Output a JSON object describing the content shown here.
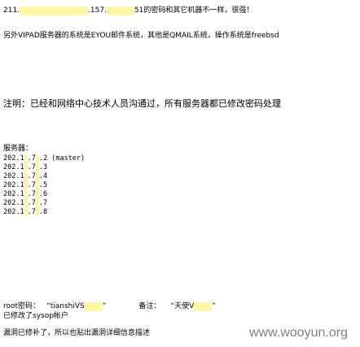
{
  "colors": {
    "text": "#000000",
    "highlight": "#fff6a6",
    "watermark": "#808080",
    "background": "#ffffff"
  },
  "intro": {
    "ip_prefix": "211.",
    "ip_middle": ".157.",
    "message": "51的密码和其它机器不一样，很强！"
  },
  "system_info": "另外VIPAD服务器的系统是EYOU邮件系统，其他是QMAIL系统，操作系统是freebsd",
  "note": "注明：已经和网络中心技术人员沟通过，所有服务器都已修改密码处理",
  "servers": {
    "label": "服务器：",
    "list": [
      {
        "prefix": "202.1",
        "mid": ".7",
        "last": ".2",
        "tag": "(master)"
      },
      {
        "prefix": "202.1",
        "mid": ".7",
        "last": ".3"
      },
      {
        "prefix": "202.1",
        "mid": ".7",
        "last": ".4"
      },
      {
        "prefix": "202.1",
        "mid": ".7",
        "last": ".5"
      },
      {
        "prefix": "202.1",
        "mid": ".7",
        "last": ".6"
      },
      {
        "prefix": "202.1",
        "mid": ".7",
        "last": ".7"
      },
      {
        "prefix": "202.1",
        "mid": ".7",
        "last": ".8"
      }
    ]
  },
  "credentials": {
    "password_label": "root密码：",
    "password_value": "“tianshiVS",
    "password_close": "”",
    "remark_label": "备注：",
    "remark_value": "“天使V",
    "remark_close": "”"
  },
  "sysop_note": "已修改了sysop帐户",
  "footer_note": "漏洞已修补了，所以也贴出漏洞详细信息描述",
  "watermark": "www.wooyun.org"
}
